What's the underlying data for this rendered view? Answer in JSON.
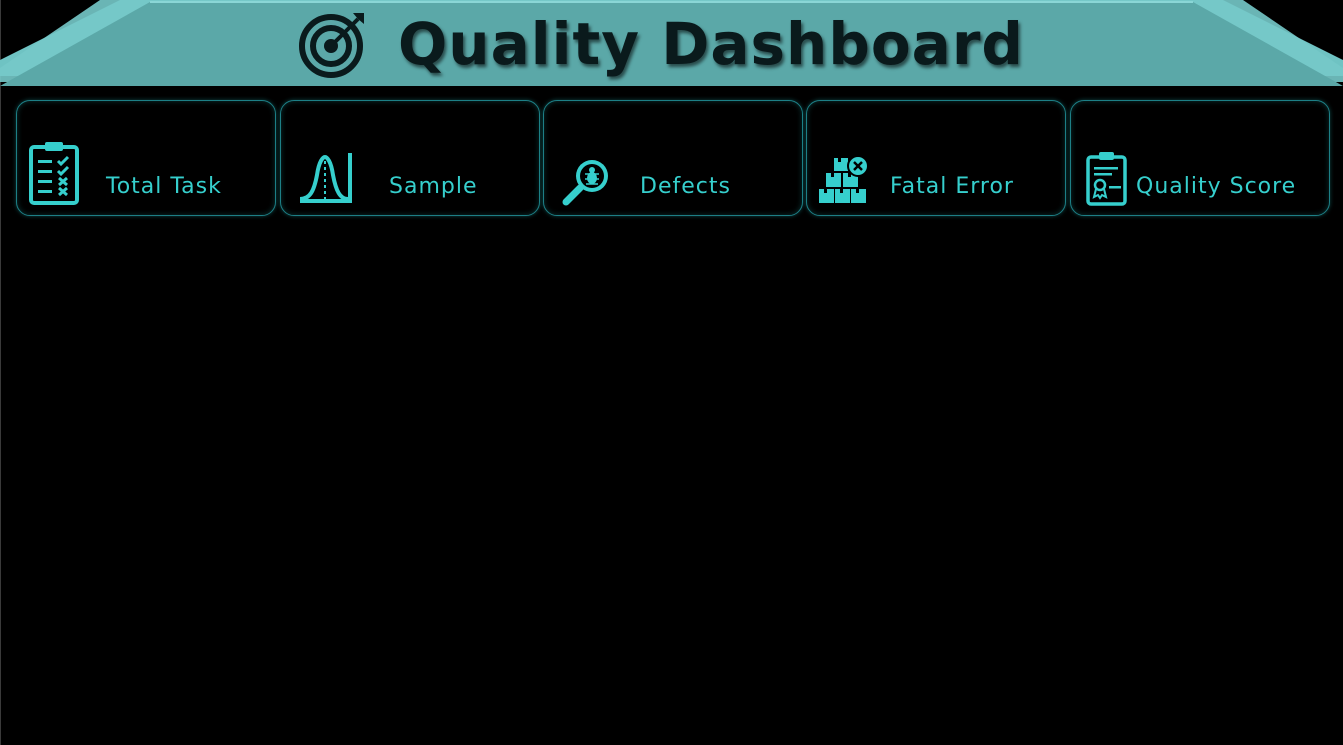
{
  "header": {
    "title": "Quality Dashboard",
    "title_icon": "target-icon"
  },
  "cards": [
    {
      "label": "Total Task",
      "icon": "clipboard-checklist-icon"
    },
    {
      "label": "Sample",
      "icon": "bell-curve-icon"
    },
    {
      "label": "Defects",
      "icon": "magnifier-bug-icon"
    },
    {
      "label": "Fatal Error",
      "icon": "boxes-error-icon"
    },
    {
      "label": "Quality Score",
      "icon": "clipboard-certificate-icon"
    }
  ],
  "colors": {
    "background": "#000000",
    "banner": "#5ba8a8",
    "banner_light": "#76c9c9",
    "accent": "#36cfcd",
    "card_border": "#1d7f86",
    "title_text": "#0a1a1c"
  }
}
